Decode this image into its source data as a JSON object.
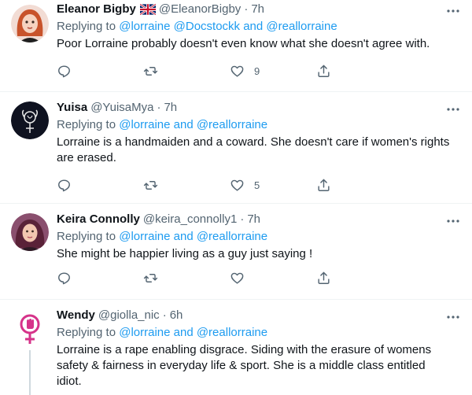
{
  "colors": {
    "link": "#1d9bf0",
    "secondary_text": "#536471",
    "primary_text": "#0f1419",
    "divider": "#eff3f4"
  },
  "tweets": [
    {
      "name": "Eleanor Bigby",
      "flag_icon": "uk-flag-icon",
      "handle": "@EleanorBigby",
      "dot": "·",
      "time": "7h",
      "replying_prefix": "Replying to",
      "replying_to": "@lorraine @Docstockk and @reallorraine",
      "text": "Poor Lorraine probably doesn't even know what she doesn't agree with.",
      "likes": "9"
    },
    {
      "name": "Yuisa",
      "handle": "@YuisaMya",
      "dot": "·",
      "time": "7h",
      "replying_prefix": "Replying to",
      "replying_to": "@lorraine and @reallorraine",
      "text": "Lorraine is a handmaiden and a coward. She doesn't care if women's rights are erased.",
      "likes": "5"
    },
    {
      "name": "Keira Connolly",
      "handle": "@keira_connolly1",
      "dot": "·",
      "time": "7h",
      "replying_prefix": "Replying to",
      "replying_to": "@lorraine and @reallorraine",
      "text": "She might be happier living as a guy just saying !",
      "likes": ""
    },
    {
      "name": "Wendy",
      "handle": "@giolla_nic",
      "dot": "·",
      "time": "6h",
      "replying_prefix": "Replying to",
      "replying_to": "@lorraine and @reallorraine",
      "text": "Lorraine is a rape enabling disgrace. Siding with the erasure of womens safety & fairness in everyday life & sport. She is a middle class  entitled idiot."
    }
  ]
}
